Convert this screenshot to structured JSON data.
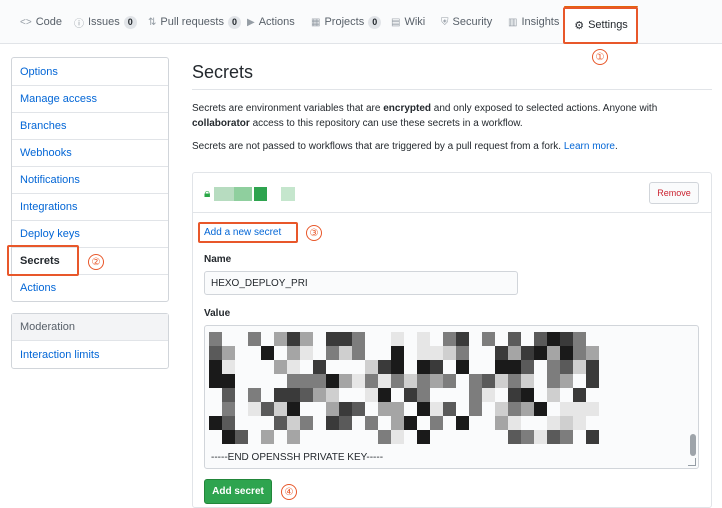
{
  "nav": {
    "tabs": [
      {
        "icon": "<>",
        "label": "Code"
      },
      {
        "icon": "ⓘ",
        "label": "Issues",
        "count": "0"
      },
      {
        "icon": "⇅",
        "label": "Pull requests",
        "count": "0"
      },
      {
        "icon": "▶",
        "label": "Actions"
      },
      {
        "icon": "▦",
        "label": "Projects",
        "count": "0"
      },
      {
        "icon": "▤",
        "label": "Wiki"
      },
      {
        "icon": "⛨",
        "label": "Security"
      },
      {
        "icon": "▥",
        "label": "Insights"
      }
    ],
    "settings": {
      "icon": "⚙",
      "label": "Settings"
    }
  },
  "annotations": {
    "one": "①",
    "two": "②",
    "three": "③",
    "four": "④"
  },
  "sidebar": {
    "items": [
      "Options",
      "Manage access",
      "Branches",
      "Webhooks",
      "Notifications",
      "Integrations",
      "Deploy keys",
      "Secrets",
      "Actions"
    ],
    "selected": "Secrets",
    "moderation_heading": "Moderation",
    "moderation_items": [
      "Interaction limits"
    ]
  },
  "main": {
    "title": "Secrets",
    "desc1_prefix": "Secrets are environment variables that are ",
    "desc1_bold1": "encrypted",
    "desc1_mid": " and only exposed to selected actions. Anyone with ",
    "desc1_bold2": "collaborator",
    "desc1_suffix": " access to this repository can use these secrets in a workflow.",
    "desc2_prefix": "Secrets are not passed to workflows that are triggered by a pull request from a fork. ",
    "desc2_link": "Learn more",
    "desc2_suffix": ".",
    "remove_label": "Remove",
    "add_new_secret": "Add a new secret",
    "name_label": "Name",
    "name_value": "HEXO_DEPLOY_PRI",
    "value_label": "Value",
    "value_tail": "-----END OPENSSH PRIVATE KEY-----",
    "add_button": "Add secret"
  },
  "colors": {
    "accent": "#0366d6",
    "primary_button": "#2ea44f",
    "annotation": "#e8572a",
    "tab_underline": "#e36209"
  }
}
